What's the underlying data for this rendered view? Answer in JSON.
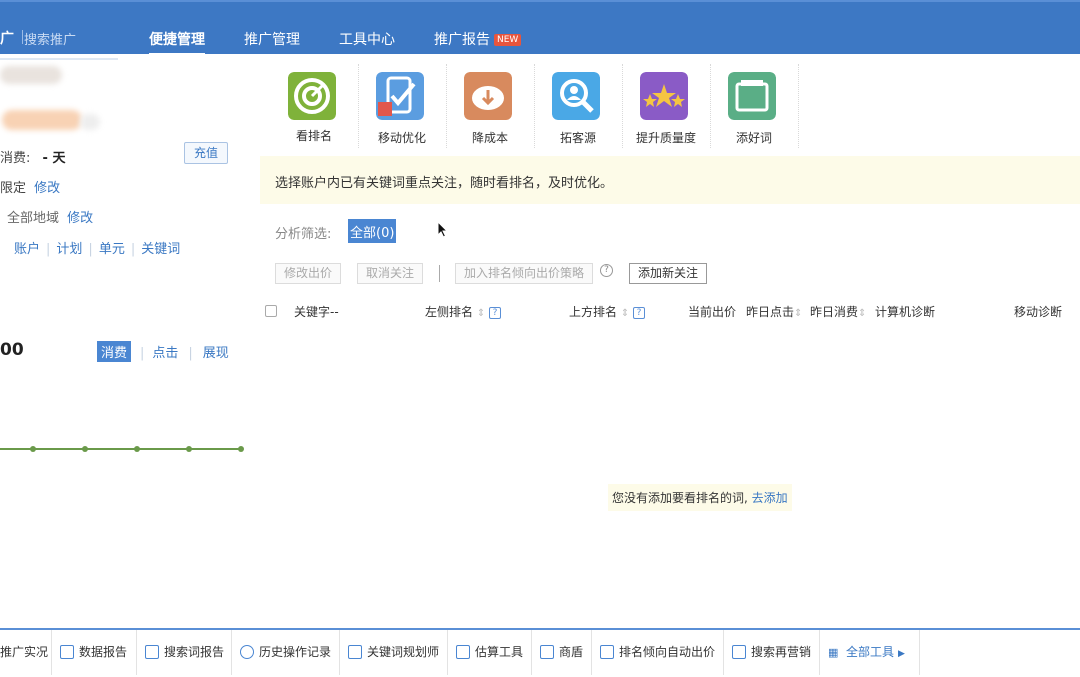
{
  "header": {
    "brand": "广",
    "brand_sub": "搜索推广",
    "nav": [
      {
        "label": "便捷管理"
      },
      {
        "label": "推广管理"
      },
      {
        "label": "工具中心"
      },
      {
        "label": "推广报告",
        "badge": "NEW"
      }
    ]
  },
  "left": {
    "consume_label": "消费:",
    "consume_value": "- 天",
    "recharge": "充值",
    "budget_label": "限定",
    "budget_edit": "修改",
    "region_label": "全部地域",
    "region_edit": "修改",
    "levels": [
      "账户",
      "计划",
      "单元",
      "关键词"
    ],
    "stat_value": "00",
    "metrics": [
      "消费",
      "点击",
      "展现"
    ],
    "trend_color": "#6a9a4a"
  },
  "tools": [
    {
      "label": "看排名",
      "icon": "target-icon",
      "color": "#7fb23a"
    },
    {
      "label": "移动优化",
      "icon": "mobile-check-icon",
      "color": "#5b9de0"
    },
    {
      "label": "降成本",
      "icon": "piggy-bank-icon",
      "color": "#d88a5e"
    },
    {
      "label": "拓客源",
      "icon": "magnify-person-icon",
      "color": "#4aa8e6"
    },
    {
      "label": "提升质量度",
      "icon": "stars-icon",
      "color": "#8a5bc6"
    },
    {
      "label": "添好词",
      "icon": "word-card-icon",
      "color": "#5aae86"
    }
  ],
  "tip": "选择账户内已有关键词重点关注，随时看排名，及时优化。",
  "filter": {
    "label": "分析筛选:",
    "selected": "全部(0)"
  },
  "actions": {
    "edit_bid": "修改出价",
    "unfollow": "取消关注",
    "add_strategy": "加入排名倾向出价策略",
    "add_follow": "添加新关注"
  },
  "table": {
    "columns": [
      "关键字--",
      "左侧排名",
      "上方排名",
      "当前出价",
      "昨日点击",
      "昨日消费",
      "计算机诊断",
      "移动诊断"
    ]
  },
  "empty": {
    "text": "您没有添加要看排名的词,",
    "link": "去添加"
  },
  "bottom": [
    {
      "label": "推广实况"
    },
    {
      "label": "数据报告"
    },
    {
      "label": "搜索词报告"
    },
    {
      "label": "历史操作记录"
    },
    {
      "label": "关键词规划师"
    },
    {
      "label": "估算工具"
    },
    {
      "label": "商盾"
    },
    {
      "label": "排名倾向自动出价"
    },
    {
      "label": "搜索再营销"
    },
    {
      "label": "全部工具"
    }
  ]
}
